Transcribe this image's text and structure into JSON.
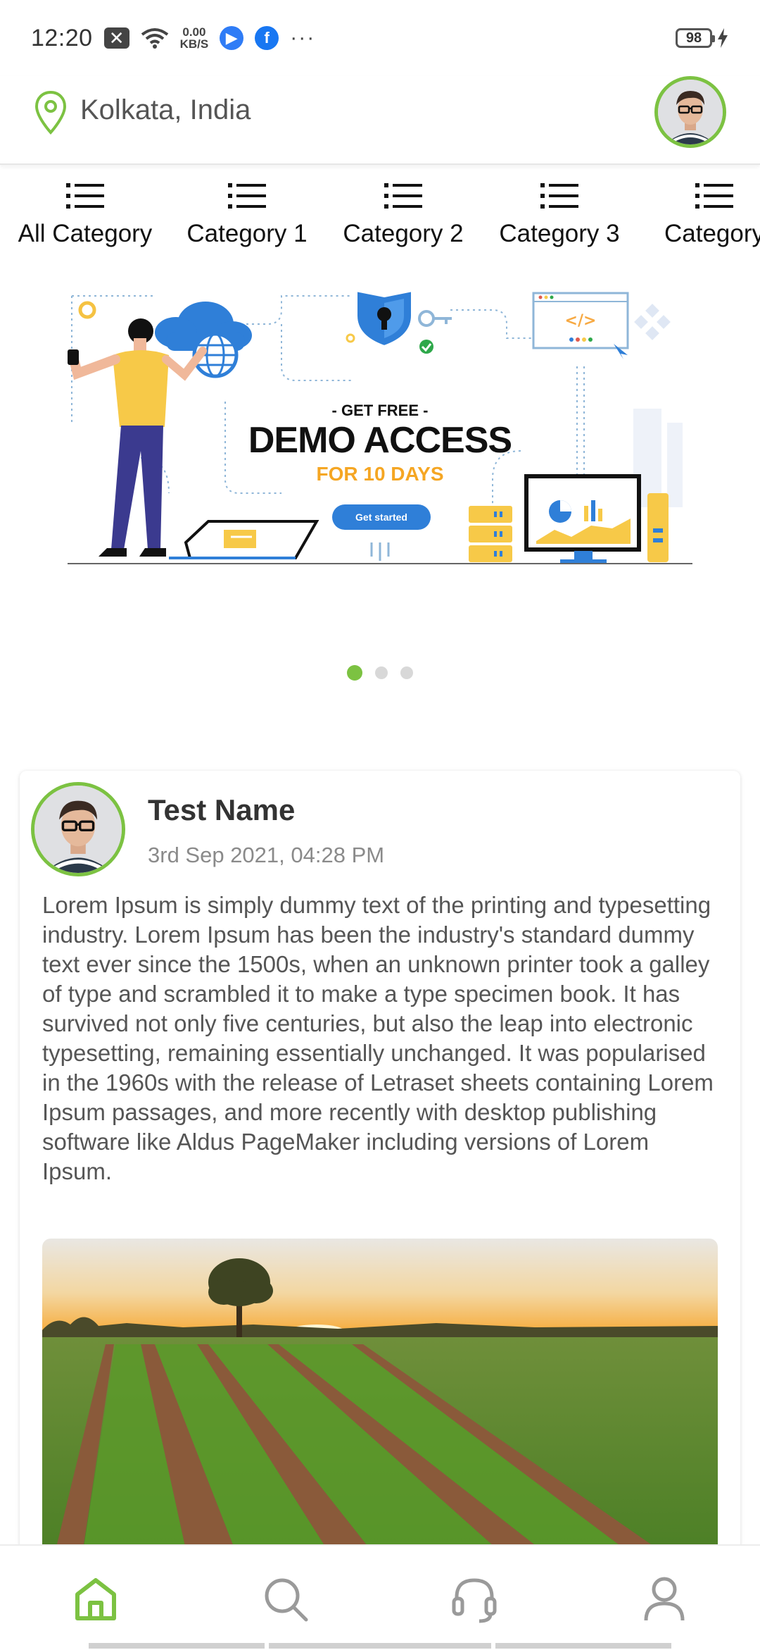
{
  "status_bar": {
    "time": "12:20",
    "net_speed_value": "0.00",
    "net_speed_unit": "KB/S",
    "more": "···",
    "battery": "98"
  },
  "header": {
    "location": "Kolkata, India"
  },
  "categories": [
    {
      "label": "All Category"
    },
    {
      "label": "Category 1"
    },
    {
      "label": "Category 2"
    },
    {
      "label": "Category 3"
    },
    {
      "label": "Category"
    }
  ],
  "banner": {
    "tagline": "- GET FREE -",
    "headline": "DEMO ACCESS",
    "subhead": "FOR 10 DAYS",
    "cta": "Get started",
    "code_tag": "</>",
    "slide_count": 3,
    "active_slide": 1
  },
  "post": {
    "author": "Test Name",
    "timestamp": "3rd Sep 2021, 04:28 PM",
    "body": "Lorem Ipsum is simply dummy text of the printing and typesetting industry. Lorem Ipsum has been the industry's standard dummy text ever since the 1500s, when an unknown printer took a galley of type and scrambled it to make a type specimen book. It has survived not only five centuries, but also the leap into electronic typesetting, remaining essentially unchanged. It was popularised in the 1960s with the release of Letraset sheets containing Lorem Ipsum passages, and more recently with desktop publishing software like Aldus PageMaker including versions of Lorem Ipsum."
  },
  "bottom_nav": [
    {
      "icon": "home-icon",
      "active": true
    },
    {
      "icon": "search-icon",
      "active": false
    },
    {
      "icon": "headset-icon",
      "active": false
    },
    {
      "icon": "profile-icon",
      "active": false
    }
  ],
  "colors": {
    "accent": "#7cc242",
    "text_dark": "#333333",
    "text_muted": "#8a8a8a",
    "icon_gray": "#9a9a9a"
  }
}
